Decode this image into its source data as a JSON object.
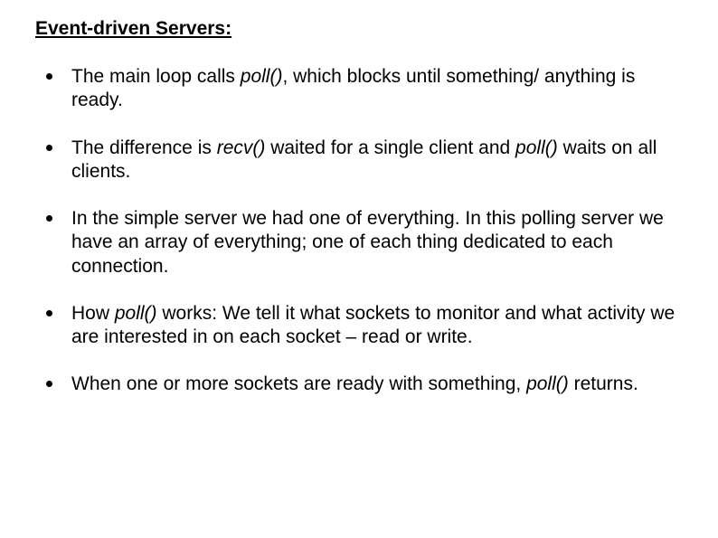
{
  "heading": "Event-driven Servers:",
  "bullets": [
    {
      "segments": [
        {
          "text": "The main loop calls ",
          "italic": false
        },
        {
          "text": "poll()",
          "italic": true
        },
        {
          "text": ", which blocks until something/ anything  is ready.",
          "italic": false
        }
      ]
    },
    {
      "segments": [
        {
          "text": "The difference is ",
          "italic": false
        },
        {
          "text": "recv()",
          "italic": true
        },
        {
          "text": " waited for a single client and ",
          "italic": false
        },
        {
          "text": "poll()",
          "italic": true
        },
        {
          "text": " waits on all clients.",
          "italic": false
        }
      ]
    },
    {
      "segments": [
        {
          "text": "In the simple server we had one of everything. In this polling server we have an array of everything; one of each thing dedicated to each connection.",
          "italic": false
        }
      ]
    },
    {
      "segments": [
        {
          "text": "How ",
          "italic": false
        },
        {
          "text": "poll()",
          "italic": true
        },
        {
          "text": " works: We tell it what sockets to monitor and what activity we are interested in on each socket – read or write.",
          "italic": false
        }
      ]
    },
    {
      "segments": [
        {
          "text": "When one or more sockets are ready with something, ",
          "italic": false
        },
        {
          "text": "poll()",
          "italic": true
        },
        {
          "text": " returns.",
          "italic": false
        }
      ]
    }
  ]
}
